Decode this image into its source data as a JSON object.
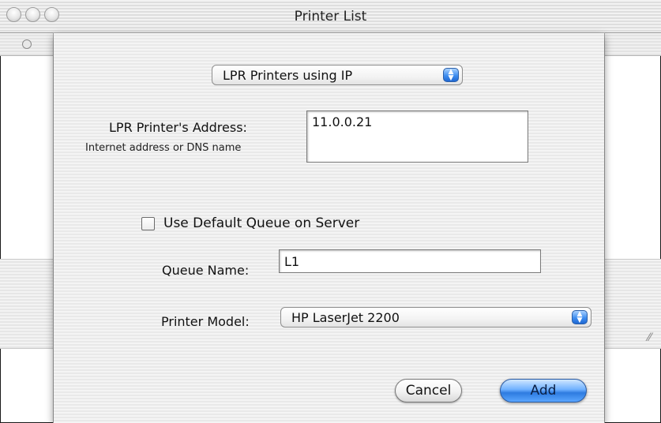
{
  "window": {
    "title": "Printer List"
  },
  "connection_popup": {
    "selected": "LPR Printers using IP"
  },
  "address": {
    "label": "LPR Printer's Address:",
    "hint": "Internet address or DNS name",
    "value": "11.0.0.21"
  },
  "default_queue": {
    "label": "Use Default Queue on Server",
    "checked": false
  },
  "queue": {
    "label": "Queue Name:",
    "value": "L1"
  },
  "model": {
    "label": "Printer Model:",
    "selected": "HP LaserJet 2200"
  },
  "buttons": {
    "cancel": "Cancel",
    "add": "Add"
  },
  "colors": {
    "accent": "#3f8ef0",
    "default_button": "#6fb1ff"
  }
}
